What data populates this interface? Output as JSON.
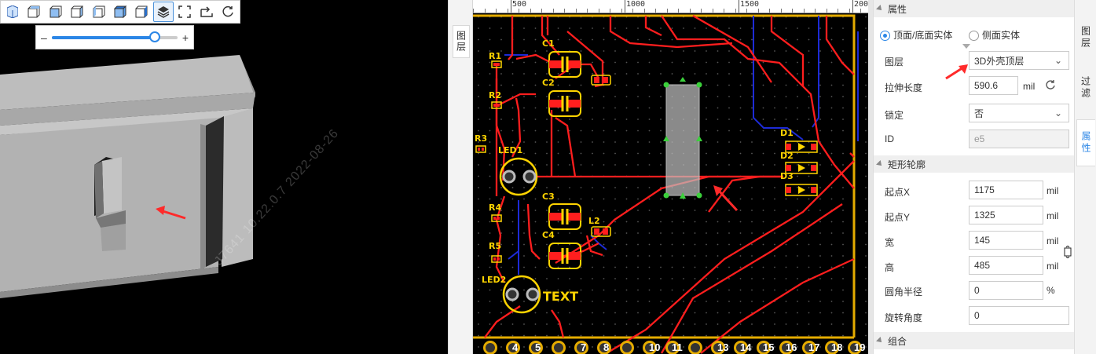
{
  "toolbar3d": {
    "buttons": [
      "view-iso-icon",
      "view-top-icon",
      "view-front-icon",
      "view-right-icon",
      "view-left-icon",
      "view-bottom-icon",
      "view-back-icon",
      "layers-icon",
      "fullscreen-icon",
      "export-icon",
      "refresh-icon"
    ],
    "active": "layers-icon"
  },
  "zoom": {
    "minus": "–",
    "plus": "+",
    "level": 0.82
  },
  "watermark": "J7641 10.22.0.7 2022-08-26",
  "gap": {
    "layer_tab": "图层"
  },
  "ruler": {
    "ticks": [
      "500",
      "1000",
      "1500",
      "200"
    ]
  },
  "pcb": {
    "designators": [
      "C1",
      "R1",
      "R2",
      "C2",
      "R3",
      "LED1",
      "D1",
      "D2",
      "D3",
      "C3",
      "R4",
      "L2",
      "C4",
      "R5",
      "LED2",
      "TEXT"
    ],
    "bottom_pads": [
      "4",
      "5",
      "7",
      "8",
      "10",
      "11",
      "13",
      "14",
      "15",
      "16",
      "17",
      "18",
      "19"
    ],
    "colors": {
      "track": "#ff1e1e",
      "blue_track": "#1d2bd6",
      "pad": "#e5ac00",
      "silk": "#ffd400",
      "dot": "#555555",
      "selection": "#bfbfbf"
    }
  },
  "props": {
    "section_attr": "属性",
    "radio_topbottom": "顶面/底面实体",
    "radio_side": "侧面实体",
    "layer_label": "图层",
    "layer_value": "3D外壳顶层",
    "extrude_label": "拉伸长度",
    "extrude_value": "590.6",
    "extrude_unit": "mil",
    "lock_label": "锁定",
    "lock_value": "否",
    "id_label": "ID",
    "id_value": "e5",
    "section_rect": "矩形轮廓",
    "startx_label": "起点X",
    "startx_value": "1175",
    "starty_label": "起点Y",
    "starty_value": "1325",
    "width_label": "宽",
    "width_value": "145",
    "height_label": "高",
    "height_value": "485",
    "radius_label": "圆角半径",
    "radius_value": "0",
    "radius_unit": "%",
    "rotate_label": "旋转角度",
    "rotate_value": "0",
    "section_group": "组合",
    "unit_mil": "mil"
  },
  "sidetabs": {
    "layers": "图层",
    "filter": "过滤",
    "props": "属性"
  }
}
